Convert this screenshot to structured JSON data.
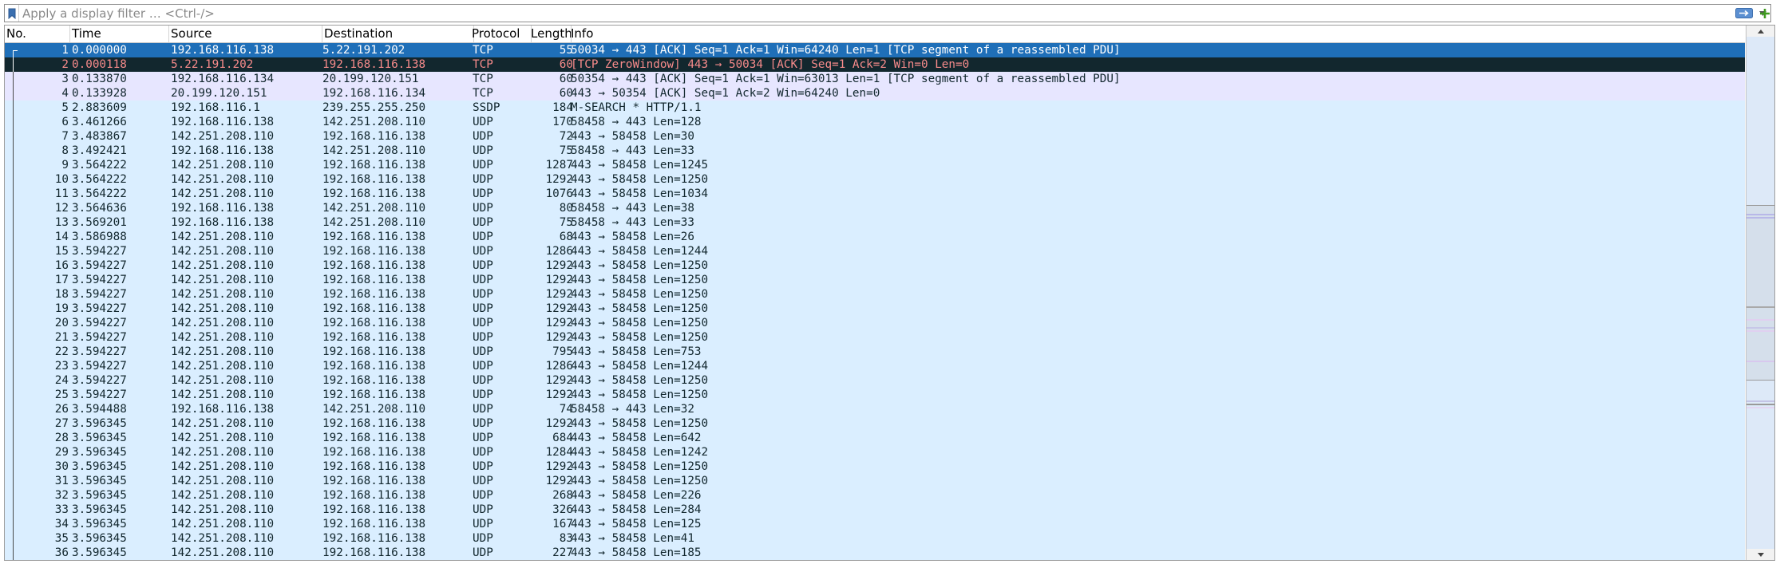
{
  "filter": {
    "placeholder": "Apply a display filter … <Ctrl-/>",
    "value": ""
  },
  "columns": {
    "no": "No.",
    "time": "Time",
    "source": "Source",
    "destination": "Destination",
    "protocol": "Protocol",
    "length": "Length",
    "info": "Info"
  },
  "colors": {
    "selected_bg": "#1f6fb8",
    "selected_fg": "#ffffff",
    "bad_bg": "#12272e",
    "bad_fg": "#f78b8b",
    "tcp_bg": "#e7e6ff",
    "udp_bg": "#daeeff",
    "fg": "#12272e"
  },
  "packets": [
    {
      "no": "1",
      "time": "0.000000",
      "src": "192.168.116.138",
      "dst": "5.22.191.202",
      "proto": "TCP",
      "len": "55",
      "info": "50034 → 443 [ACK] Seq=1 Ack=1 Win=64240 Len=1 [TCP segment of a reassembled PDU]",
      "style": "selected"
    },
    {
      "no": "2",
      "time": "0.000118",
      "src": "5.22.191.202",
      "dst": "192.168.116.138",
      "proto": "TCP",
      "len": "60",
      "info": "[TCP ZeroWindow] 443 → 50034 [ACK] Seq=1 Ack=2 Win=0 Len=0",
      "style": "bad"
    },
    {
      "no": "3",
      "time": "0.133870",
      "src": "192.168.116.134",
      "dst": "20.199.120.151",
      "proto": "TCP",
      "len": "60",
      "info": "50354 → 443 [ACK] Seq=1 Ack=1 Win=63013 Len=1 [TCP segment of a reassembled PDU]",
      "style": "tcp"
    },
    {
      "no": "4",
      "time": "0.133928",
      "src": "20.199.120.151",
      "dst": "192.168.116.134",
      "proto": "TCP",
      "len": "60",
      "info": "443 → 50354 [ACK] Seq=1 Ack=2 Win=64240 Len=0",
      "style": "tcp"
    },
    {
      "no": "5",
      "time": "2.883609",
      "src": "192.168.116.1",
      "dst": "239.255.255.250",
      "proto": "SSDP",
      "len": "184",
      "info": "M-SEARCH * HTTP/1.1",
      "style": "udp"
    },
    {
      "no": "6",
      "time": "3.461266",
      "src": "192.168.116.138",
      "dst": "142.251.208.110",
      "proto": "UDP",
      "len": "170",
      "info": "58458 → 443 Len=128",
      "style": "udp"
    },
    {
      "no": "7",
      "time": "3.483867",
      "src": "142.251.208.110",
      "dst": "192.168.116.138",
      "proto": "UDP",
      "len": "72",
      "info": "443 → 58458 Len=30",
      "style": "udp"
    },
    {
      "no": "8",
      "time": "3.492421",
      "src": "192.168.116.138",
      "dst": "142.251.208.110",
      "proto": "UDP",
      "len": "75",
      "info": "58458 → 443 Len=33",
      "style": "udp"
    },
    {
      "no": "9",
      "time": "3.564222",
      "src": "142.251.208.110",
      "dst": "192.168.116.138",
      "proto": "UDP",
      "len": "1287",
      "info": "443 → 58458 Len=1245",
      "style": "udp"
    },
    {
      "no": "10",
      "time": "3.564222",
      "src": "142.251.208.110",
      "dst": "192.168.116.138",
      "proto": "UDP",
      "len": "1292",
      "info": "443 → 58458 Len=1250",
      "style": "udp"
    },
    {
      "no": "11",
      "time": "3.564222",
      "src": "142.251.208.110",
      "dst": "192.168.116.138",
      "proto": "UDP",
      "len": "1076",
      "info": "443 → 58458 Len=1034",
      "style": "udp"
    },
    {
      "no": "12",
      "time": "3.564636",
      "src": "192.168.116.138",
      "dst": "142.251.208.110",
      "proto": "UDP",
      "len": "80",
      "info": "58458 → 443 Len=38",
      "style": "udp"
    },
    {
      "no": "13",
      "time": "3.569201",
      "src": "192.168.116.138",
      "dst": "142.251.208.110",
      "proto": "UDP",
      "len": "75",
      "info": "58458 → 443 Len=33",
      "style": "udp"
    },
    {
      "no": "14",
      "time": "3.586988",
      "src": "142.251.208.110",
      "dst": "192.168.116.138",
      "proto": "UDP",
      "len": "68",
      "info": "443 → 58458 Len=26",
      "style": "udp"
    },
    {
      "no": "15",
      "time": "3.594227",
      "src": "142.251.208.110",
      "dst": "192.168.116.138",
      "proto": "UDP",
      "len": "1286",
      "info": "443 → 58458 Len=1244",
      "style": "udp"
    },
    {
      "no": "16",
      "time": "3.594227",
      "src": "142.251.208.110",
      "dst": "192.168.116.138",
      "proto": "UDP",
      "len": "1292",
      "info": "443 → 58458 Len=1250",
      "style": "udp"
    },
    {
      "no": "17",
      "time": "3.594227",
      "src": "142.251.208.110",
      "dst": "192.168.116.138",
      "proto": "UDP",
      "len": "1292",
      "info": "443 → 58458 Len=1250",
      "style": "udp"
    },
    {
      "no": "18",
      "time": "3.594227",
      "src": "142.251.208.110",
      "dst": "192.168.116.138",
      "proto": "UDP",
      "len": "1292",
      "info": "443 → 58458 Len=1250",
      "style": "udp"
    },
    {
      "no": "19",
      "time": "3.594227",
      "src": "142.251.208.110",
      "dst": "192.168.116.138",
      "proto": "UDP",
      "len": "1292",
      "info": "443 → 58458 Len=1250",
      "style": "udp"
    },
    {
      "no": "20",
      "time": "3.594227",
      "src": "142.251.208.110",
      "dst": "192.168.116.138",
      "proto": "UDP",
      "len": "1292",
      "info": "443 → 58458 Len=1250",
      "style": "udp"
    },
    {
      "no": "21",
      "time": "3.594227",
      "src": "142.251.208.110",
      "dst": "192.168.116.138",
      "proto": "UDP",
      "len": "1292",
      "info": "443 → 58458 Len=1250",
      "style": "udp"
    },
    {
      "no": "22",
      "time": "3.594227",
      "src": "142.251.208.110",
      "dst": "192.168.116.138",
      "proto": "UDP",
      "len": "795",
      "info": "443 → 58458 Len=753",
      "style": "udp"
    },
    {
      "no": "23",
      "time": "3.594227",
      "src": "142.251.208.110",
      "dst": "192.168.116.138",
      "proto": "UDP",
      "len": "1286",
      "info": "443 → 58458 Len=1244",
      "style": "udp"
    },
    {
      "no": "24",
      "time": "3.594227",
      "src": "142.251.208.110",
      "dst": "192.168.116.138",
      "proto": "UDP",
      "len": "1292",
      "info": "443 → 58458 Len=1250",
      "style": "udp"
    },
    {
      "no": "25",
      "time": "3.594227",
      "src": "142.251.208.110",
      "dst": "192.168.116.138",
      "proto": "UDP",
      "len": "1292",
      "info": "443 → 58458 Len=1250",
      "style": "udp"
    },
    {
      "no": "26",
      "time": "3.594488",
      "src": "192.168.116.138",
      "dst": "142.251.208.110",
      "proto": "UDP",
      "len": "74",
      "info": "58458 → 443 Len=32",
      "style": "udp"
    },
    {
      "no": "27",
      "time": "3.596345",
      "src": "142.251.208.110",
      "dst": "192.168.116.138",
      "proto": "UDP",
      "len": "1292",
      "info": "443 → 58458 Len=1250",
      "style": "udp"
    },
    {
      "no": "28",
      "time": "3.596345",
      "src": "142.251.208.110",
      "dst": "192.168.116.138",
      "proto": "UDP",
      "len": "684",
      "info": "443 → 58458 Len=642",
      "style": "udp"
    },
    {
      "no": "29",
      "time": "3.596345",
      "src": "142.251.208.110",
      "dst": "192.168.116.138",
      "proto": "UDP",
      "len": "1284",
      "info": "443 → 58458 Len=1242",
      "style": "udp"
    },
    {
      "no": "30",
      "time": "3.596345",
      "src": "142.251.208.110",
      "dst": "192.168.116.138",
      "proto": "UDP",
      "len": "1292",
      "info": "443 → 58458 Len=1250",
      "style": "udp"
    },
    {
      "no": "31",
      "time": "3.596345",
      "src": "142.251.208.110",
      "dst": "192.168.116.138",
      "proto": "UDP",
      "len": "1292",
      "info": "443 → 58458 Len=1250",
      "style": "udp"
    },
    {
      "no": "32",
      "time": "3.596345",
      "src": "142.251.208.110",
      "dst": "192.168.116.138",
      "proto": "UDP",
      "len": "268",
      "info": "443 → 58458 Len=226",
      "style": "udp"
    },
    {
      "no": "33",
      "time": "3.596345",
      "src": "142.251.208.110",
      "dst": "192.168.116.138",
      "proto": "UDP",
      "len": "326",
      "info": "443 → 58458 Len=284",
      "style": "udp"
    },
    {
      "no": "34",
      "time": "3.596345",
      "src": "142.251.208.110",
      "dst": "192.168.116.138",
      "proto": "UDP",
      "len": "167",
      "info": "443 → 58458 Len=125",
      "style": "udp"
    },
    {
      "no": "35",
      "time": "3.596345",
      "src": "142.251.208.110",
      "dst": "192.168.116.138",
      "proto": "UDP",
      "len": "83",
      "info": "443 → 58458 Len=41",
      "style": "udp"
    },
    {
      "no": "36",
      "time": "3.596345",
      "src": "142.251.208.110",
      "dst": "192.168.116.138",
      "proto": "UDP",
      "len": "227",
      "info": "443 → 58458 Len=185",
      "style": "udp"
    }
  ]
}
